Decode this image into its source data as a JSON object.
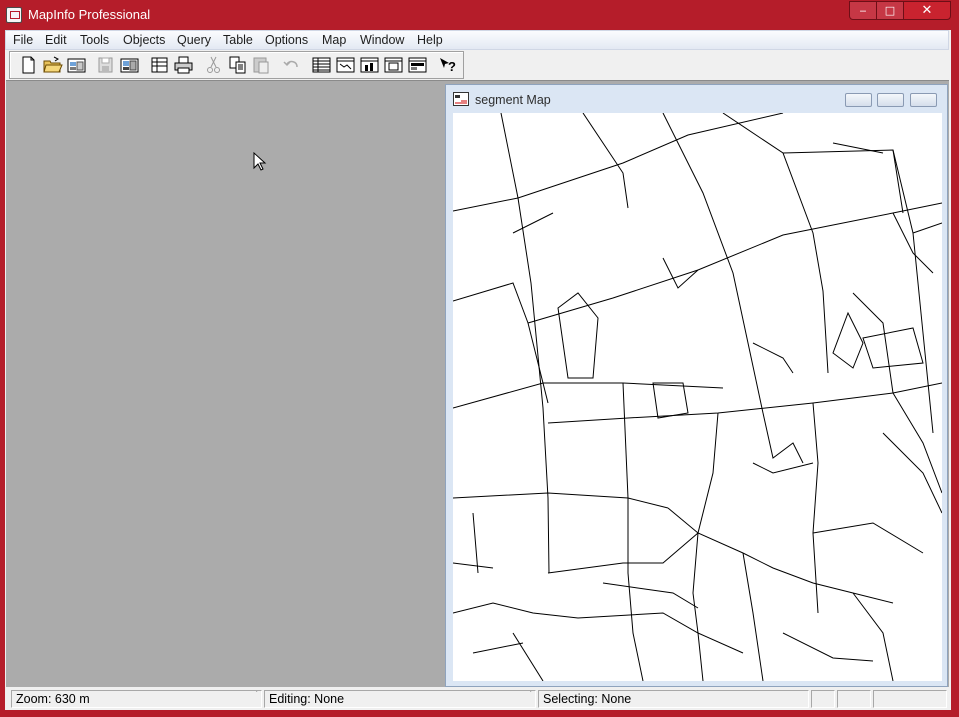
{
  "app": {
    "title": "MapInfo Professional"
  },
  "window_controls": {
    "minimize": "‒",
    "maximize": "□",
    "close": "✕"
  },
  "menubar": {
    "items": [
      "File",
      "Edit",
      "Tools",
      "Objects",
      "Query",
      "Table",
      "Options",
      "Map",
      "Window",
      "Help"
    ]
  },
  "toolbar": {
    "buttons": [
      "new-table-icon",
      "open-table-icon",
      "open-workspace-icon",
      "save-table-icon",
      "save-workspace-icon",
      "close-table-icon",
      "print-icon",
      "cut-icon",
      "copy-icon",
      "paste-icon",
      "undo-icon",
      "new-browser-icon",
      "new-mapper-icon",
      "new-grapher-icon",
      "new-layout-icon",
      "new-redistrict-icon",
      "help-icon"
    ]
  },
  "map_window": {
    "title": "segment Map"
  },
  "statusbar": {
    "zoom": "Zoom: 630 m",
    "editing": "Editing: None",
    "selecting": "Selecting: None",
    "tick": "`"
  },
  "colors": {
    "frame": "#b51d2a",
    "workspace": "#ababab",
    "map_bg": "#ffffff",
    "street_lines": "#000000"
  }
}
